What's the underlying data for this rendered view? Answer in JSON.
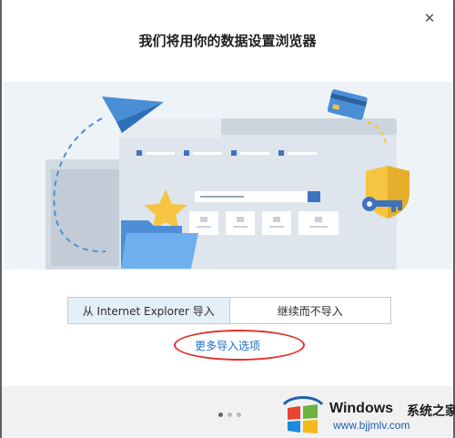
{
  "dialog": {
    "title": "我们将用你的数据设置浏览器",
    "close_glyph": "✕",
    "buttons": {
      "import_ie": "从 Internet Explorer 导入",
      "continue_no_import": "继续而不导入"
    },
    "more_options_link": "更多导入选项"
  },
  "pager": {
    "total": 3,
    "current": 1
  },
  "watermark": {
    "brand": "Windows",
    "suffix": "系统之家",
    "url": "www.bjjmlv.com"
  },
  "colors": {
    "accent_blue": "#4a90d9",
    "folder_blue": "#5fa5e8",
    "star_yellow": "#f5c542",
    "shield_yellow": "#f5c542",
    "annotation_red": "#e0302b",
    "link_blue": "#1f6fc5"
  }
}
